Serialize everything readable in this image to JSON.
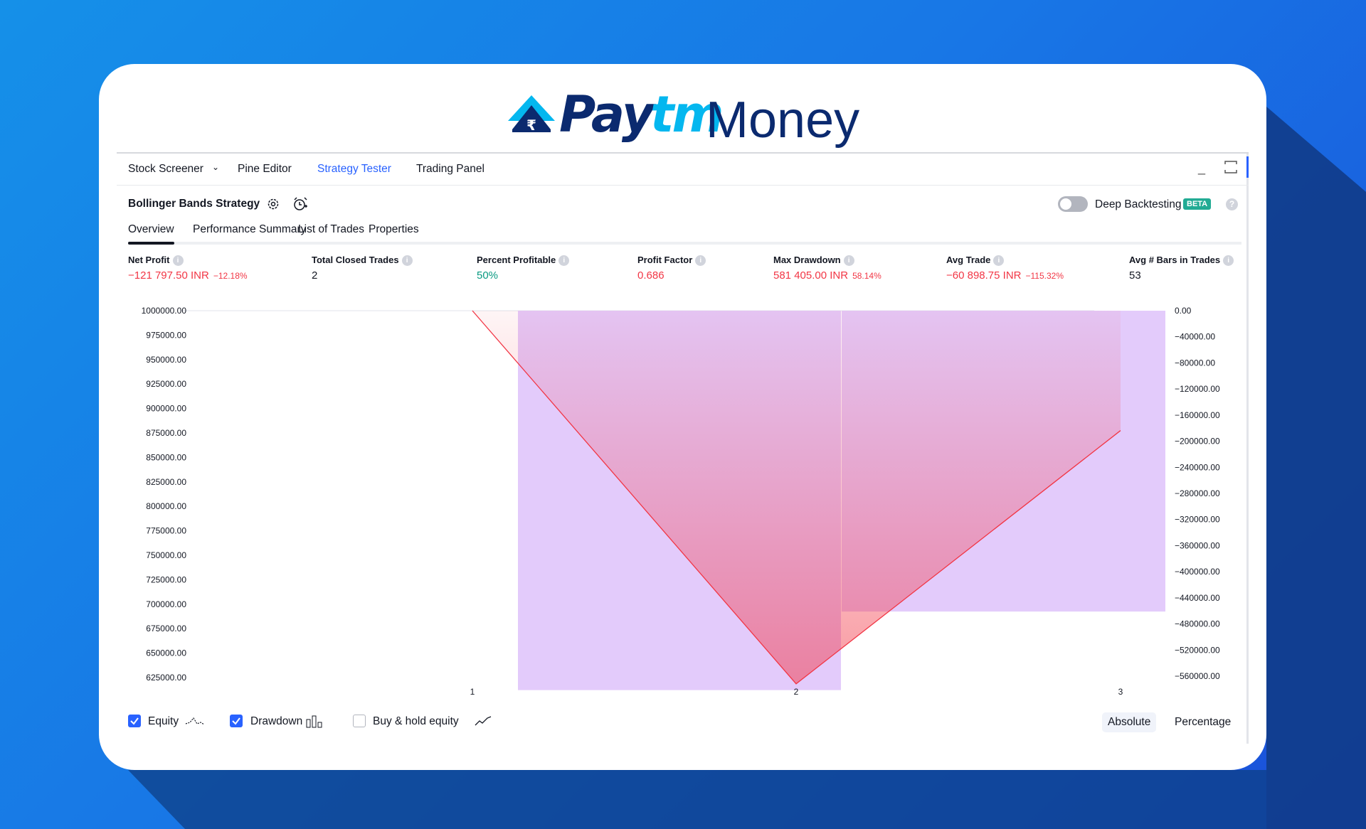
{
  "brand": {
    "pay": "Pay",
    "tm": "tm",
    "money": "Money"
  },
  "topnav": {
    "items": [
      "Stock Screener",
      "Pine Editor",
      "Strategy Tester",
      "Trading Panel"
    ],
    "active": "Strategy Tester"
  },
  "strategy": {
    "title": "Bollinger Bands Strategy",
    "deep_backtesting_label": "Deep Backtesting",
    "beta_badge": "BETA",
    "help": "?"
  },
  "tabs": [
    "Overview",
    "Performance Summary",
    "List of Trades",
    "Properties"
  ],
  "metrics": [
    {
      "label": "Net Profit",
      "value": "−121 797.50 INR",
      "sub": "−12.18%",
      "color": "#f23645"
    },
    {
      "label": "Total Closed Trades",
      "value": "2",
      "sub": "",
      "color": "#131722"
    },
    {
      "label": "Percent Profitable",
      "value": "50%",
      "sub": "",
      "color": "#089981"
    },
    {
      "label": "Profit Factor",
      "value": "0.686",
      "sub": "",
      "color": "#f23645"
    },
    {
      "label": "Max Drawdown",
      "value": "581 405.00 INR",
      "sub": "58.14%",
      "color": "#f23645"
    },
    {
      "label": "Avg Trade",
      "value": "−60 898.75 INR",
      "sub": "−115.32%",
      "color": "#f23645"
    },
    {
      "label": "Avg # Bars in Trades",
      "value": "53",
      "sub": "",
      "color": "#131722"
    }
  ],
  "chart_data": {
    "type": "line",
    "x": [
      "1",
      "2",
      "3"
    ],
    "series": [
      {
        "name": "Equity",
        "values": [
          1000000,
          618600,
          877500
        ],
        "color": "#f23645"
      },
      {
        "name": "Drawdown",
        "values": [
          -581405,
          -461000
        ],
        "color": "#e1c8fb"
      }
    ],
    "left_axis": {
      "ylim": [
        625000,
        1000000
      ],
      "ticks": [
        "1000000.00",
        "975000.00",
        "950000.00",
        "925000.00",
        "900000.00",
        "875000.00",
        "850000.00",
        "825000.00",
        "800000.00",
        "775000.00",
        "750000.00",
        "725000.00",
        "700000.00",
        "675000.00",
        "650000.00",
        "625000.00"
      ]
    },
    "right_axis": {
      "ylim": [
        -560000,
        0
      ],
      "ticks": [
        "0.00",
        "−40000.00",
        "−80000.00",
        "−120000.00",
        "−160000.00",
        "−200000.00",
        "−240000.00",
        "−280000.00",
        "−320000.00",
        "−360000.00",
        "−400000.00",
        "−440000.00",
        "−480000.00",
        "−520000.00",
        "−560000.00"
      ]
    }
  },
  "legend": {
    "equity": {
      "label": "Equity",
      "checked": true
    },
    "drawdown": {
      "label": "Drawdown",
      "checked": true
    },
    "buy_hold": {
      "label": "Buy & hold equity",
      "checked": false
    },
    "absolute": "Absolute",
    "percentage": "Percentage"
  }
}
